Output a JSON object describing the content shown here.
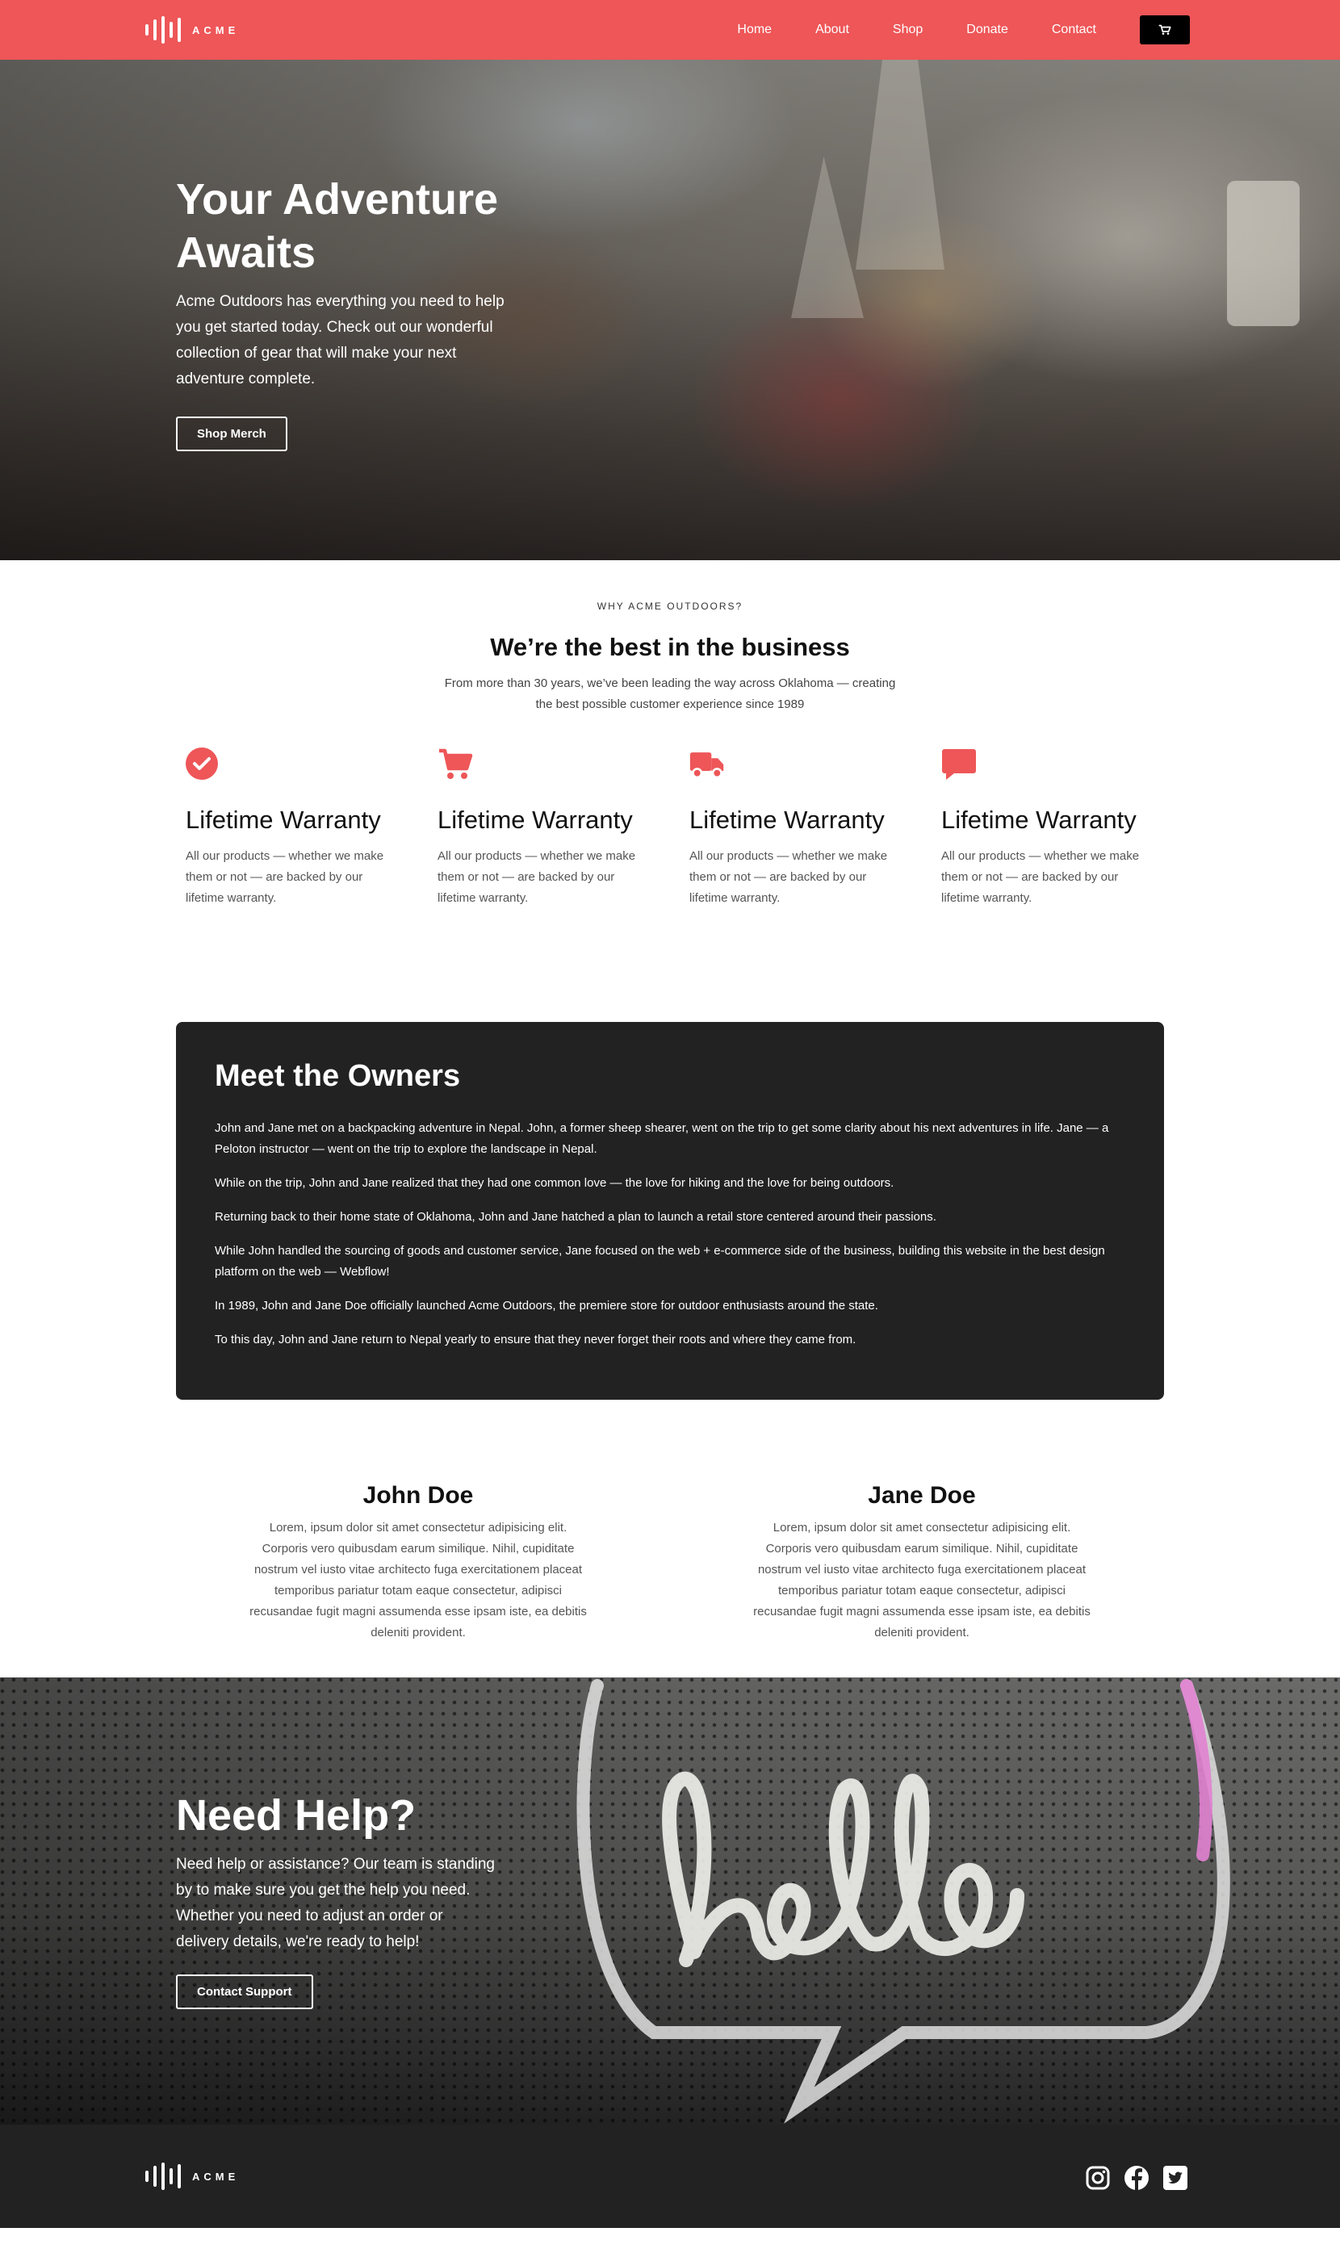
{
  "brand": {
    "name": "ACME",
    "logo_icon": "soundwave-logo-icon"
  },
  "nav": {
    "links": [
      "Home",
      "About",
      "Shop",
      "Donate",
      "Contact"
    ],
    "cart_icon": "cart-icon"
  },
  "hero": {
    "title": "Your Adventure Awaits",
    "text": "Acme Outdoors has everything you need to help you get started today. Check out our wonderful collection of gear that will make your next adventure complete.",
    "button": "Shop Merch"
  },
  "why": {
    "eyebrow": "WHY ACME OUTDOORS?",
    "title": "We’re the best in the business",
    "subtitle": "From more than 30 years, we’ve been leading the way across Oklahoma — creating the best possible customer experience since 1989"
  },
  "features": [
    {
      "icon": "check-circle-icon",
      "title": "Lifetime Warranty",
      "text": "All our products — whether we make them or not — are backed by our lifetime warranty."
    },
    {
      "icon": "shopping-cart-icon",
      "title": "Lifetime Warranty",
      "text": "All our products — whether we make them or not — are backed by our lifetime warranty."
    },
    {
      "icon": "delivery-truck-icon",
      "title": "Lifetime Warranty",
      "text": "All our products — whether we make them or not — are backed by our lifetime warranty."
    },
    {
      "icon": "chat-bubble-icon",
      "title": "Lifetime Warranty",
      "text": "All our products — whether we make them or not — are backed by our lifetime warranty."
    }
  ],
  "owners": {
    "title": "Meet the Owners",
    "paragraphs": [
      "John and Jane met on a backpacking adventure in Nepal. John, a former sheep shearer, went on the trip to get some clarity about his next adventures in life. Jane — a Peloton instructor — went on the trip to explore the landscape in Nepal.",
      "While on the trip, John and Jane realized that they had one common love — the love for hiking and the love for being outdoors.",
      "Returning back to their home state of Oklahoma, John and Jane hatched a plan to launch a retail store centered around their passions.",
      "While John handled the sourcing of goods and customer service, Jane focused on the web + e-commerce side of the business, building this website in the best design platform on the web — Webflow!",
      "In 1989, John and Jane Doe officially launched Acme Outdoors, the premiere store for outdoor enthusiasts around the state.",
      "To this day, John and Jane return to Nepal yearly to ensure that they never forget their roots and where they came from."
    ]
  },
  "people": [
    {
      "name": "John Doe",
      "bio": "Lorem, ipsum dolor sit amet consectetur adipisicing elit. Corporis vero quibusdam earum similique. Nihil, cupiditate nostrum vel iusto vitae architecto fuga exercitationem placeat temporibus pariatur totam eaque consectetur, adipisci recusandae fugit magni assumenda esse ipsam iste, ea debitis deleniti provident."
    },
    {
      "name": "Jane Doe",
      "bio": "Lorem, ipsum dolor sit amet consectetur adipisicing elit. Corporis vero quibusdam earum similique. Nihil, cupiditate nostrum vel iusto vitae architecto fuga exercitationem placeat temporibus pariatur totam eaque consectetur, adipisci recusandae fugit magni assumenda esse ipsam iste, ea debitis deleniti provident."
    }
  ],
  "help": {
    "title": "Need Help?",
    "text": "Need help or assistance? Our team is standing by to make sure you get the help you need. Whether you need to adjust an order or delivery details, we're ready to help!",
    "button": "Contact Support"
  },
  "footer": {
    "social_icons": [
      "instagram-icon",
      "facebook-icon",
      "twitter-icon"
    ]
  },
  "colors": {
    "brand": "#ee5658",
    "dark": "#222222",
    "white": "#ffffff"
  }
}
